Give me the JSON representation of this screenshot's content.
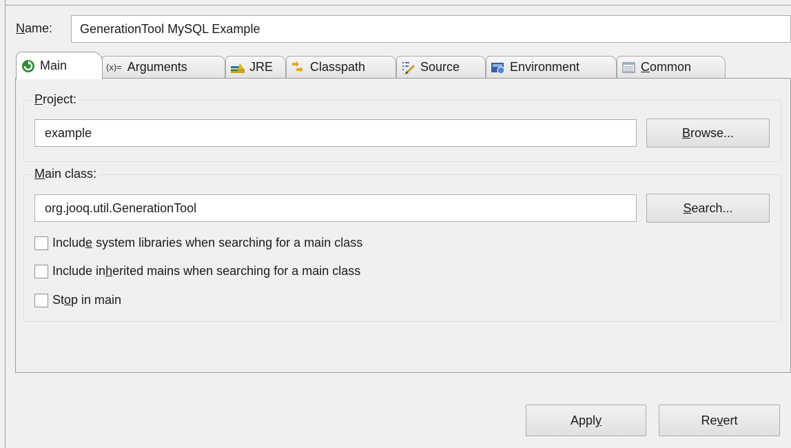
{
  "name": {
    "label_prefix": "",
    "label_mnemonic": "N",
    "label_rest": "ame:",
    "value": "GenerationTool MySQL Example"
  },
  "tabs": [
    {
      "icon": "main-run-icon",
      "label_pre": "Main",
      "label_mn": "",
      "label_post": ""
    },
    {
      "icon": "arguments-icon",
      "icon_text": "(x)=",
      "label_pre": "Arguments",
      "label_mn": "",
      "label_post": ""
    },
    {
      "icon": "jre-icon",
      "label_pre": "JRE",
      "label_mn": "",
      "label_post": ""
    },
    {
      "icon": "classpath-icon",
      "label_pre": "Classpath",
      "label_mn": "",
      "label_post": ""
    },
    {
      "icon": "source-icon",
      "label_pre": "Source",
      "label_mn": "",
      "label_post": ""
    },
    {
      "icon": "environment-icon",
      "label_pre": "Environment",
      "label_mn": "",
      "label_post": ""
    },
    {
      "icon": "common-icon",
      "label_pre": "",
      "label_mn": "C",
      "label_post": "ommon"
    }
  ],
  "project": {
    "label_mn": "P",
    "label_rest": "roject:",
    "value": "example",
    "browse_mn": "B",
    "browse_rest": "rowse..."
  },
  "main_class": {
    "label_mn": "M",
    "label_rest": "ain class:",
    "value": "org.jooq.util.GenerationTool",
    "search_mn": "S",
    "search_rest": "earch..."
  },
  "options": [
    {
      "pre": "Includ",
      "mn": "e",
      "post": " system libraries when searching for a main class",
      "checked": false
    },
    {
      "pre": "Include in",
      "mn": "h",
      "post": "erited mains when searching for a main class",
      "checked": false
    },
    {
      "pre": "St",
      "mn": "o",
      "post": "p in main",
      "checked": false
    }
  ],
  "footer": {
    "apply_pre": "Appl",
    "apply_mn": "y",
    "revert_pre": "Re",
    "revert_mn": "v",
    "revert_post": "ert"
  },
  "colors": {
    "main_icon": "#2e8b3a",
    "jre_icon": "#c8a020",
    "environment_icon": "#3a5fa8"
  }
}
